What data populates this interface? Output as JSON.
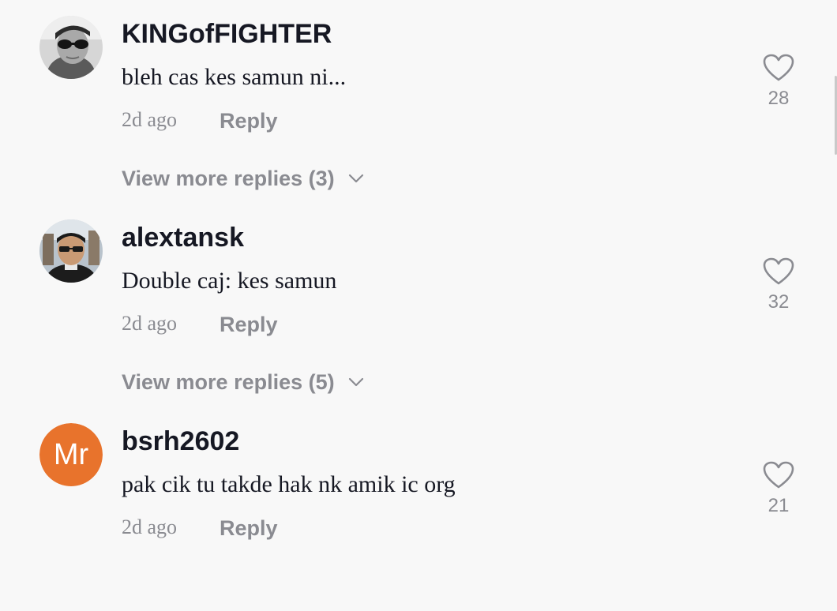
{
  "colors": {
    "background": "#f8f8f8",
    "text_primary": "#161823",
    "text_secondary": "#8a8b91",
    "initials_avatar_bg": "#e8732c"
  },
  "comments": [
    {
      "username": "KINGofFIGHTER",
      "text": "bleh cas kes samun ni...",
      "time": "2d ago",
      "reply_label": "Reply",
      "likes": "28",
      "like_icon": "heart-outline-icon",
      "view_more_label": "View more replies (3)",
      "view_more_icon": "chevron-down-icon"
    },
    {
      "username": "alextansk",
      "text": "Double caj: kes samun",
      "time": "2d ago",
      "reply_label": "Reply",
      "likes": "32",
      "like_icon": "heart-outline-icon",
      "view_more_label": "View more replies (5)",
      "view_more_icon": "chevron-down-icon"
    },
    {
      "username": "bsrh2602",
      "avatar_initials": "Mr",
      "text": "pak cik tu takde hak nk amik ic org",
      "time": "2d ago",
      "reply_label": "Reply",
      "likes": "21",
      "like_icon": "heart-outline-icon"
    }
  ]
}
